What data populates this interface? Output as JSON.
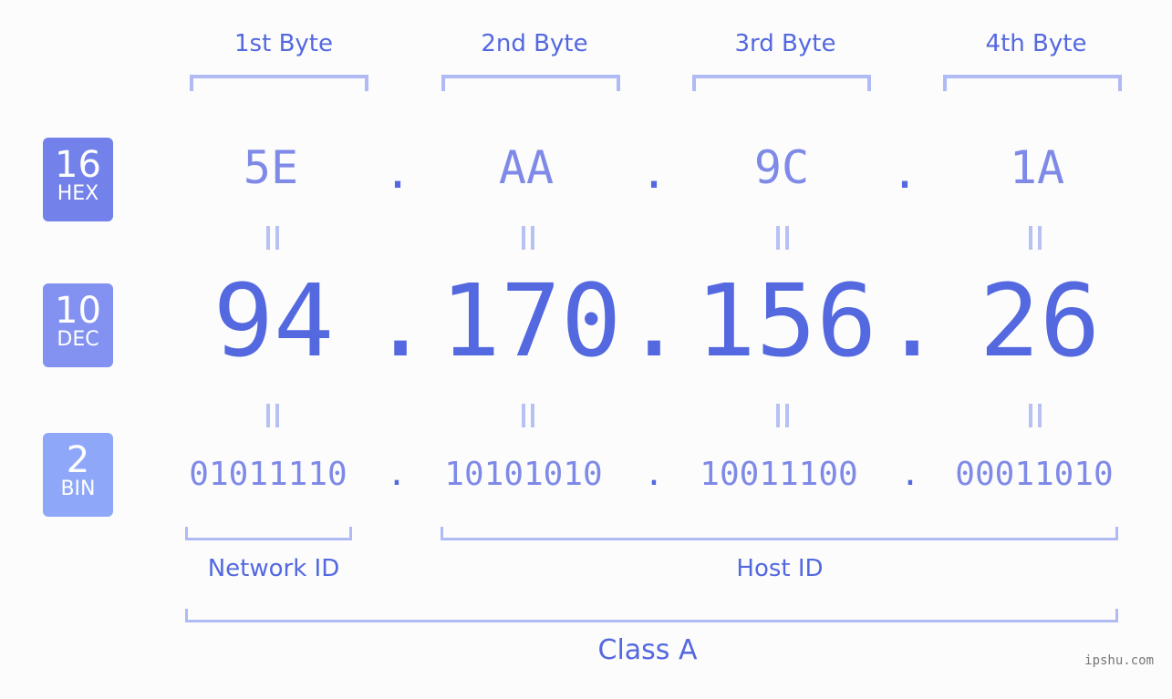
{
  "bytes": [
    {
      "header": "1st Byte",
      "hex": "5E",
      "dec": "94",
      "bin": "01011110"
    },
    {
      "header": "2nd Byte",
      "hex": "AA",
      "dec": "170",
      "bin": "10101010"
    },
    {
      "header": "3rd Byte",
      "hex": "9C",
      "dec": "156",
      "bin": "10011100"
    },
    {
      "header": "4th Byte",
      "hex": "1A",
      "dec": "26",
      "bin": "00011010"
    }
  ],
  "separator": ".",
  "badges": {
    "hex": {
      "base": "16",
      "label": "HEX",
      "color": "#7381ea"
    },
    "dec": {
      "base": "10",
      "label": "DEC",
      "color": "#8392f0"
    },
    "bin": {
      "base": "2",
      "label": "BIN",
      "color": "#8fa7f8"
    }
  },
  "network_label": "Network ID",
  "host_label": "Host ID",
  "class_label": "Class A",
  "watermark": "ipshu.com"
}
